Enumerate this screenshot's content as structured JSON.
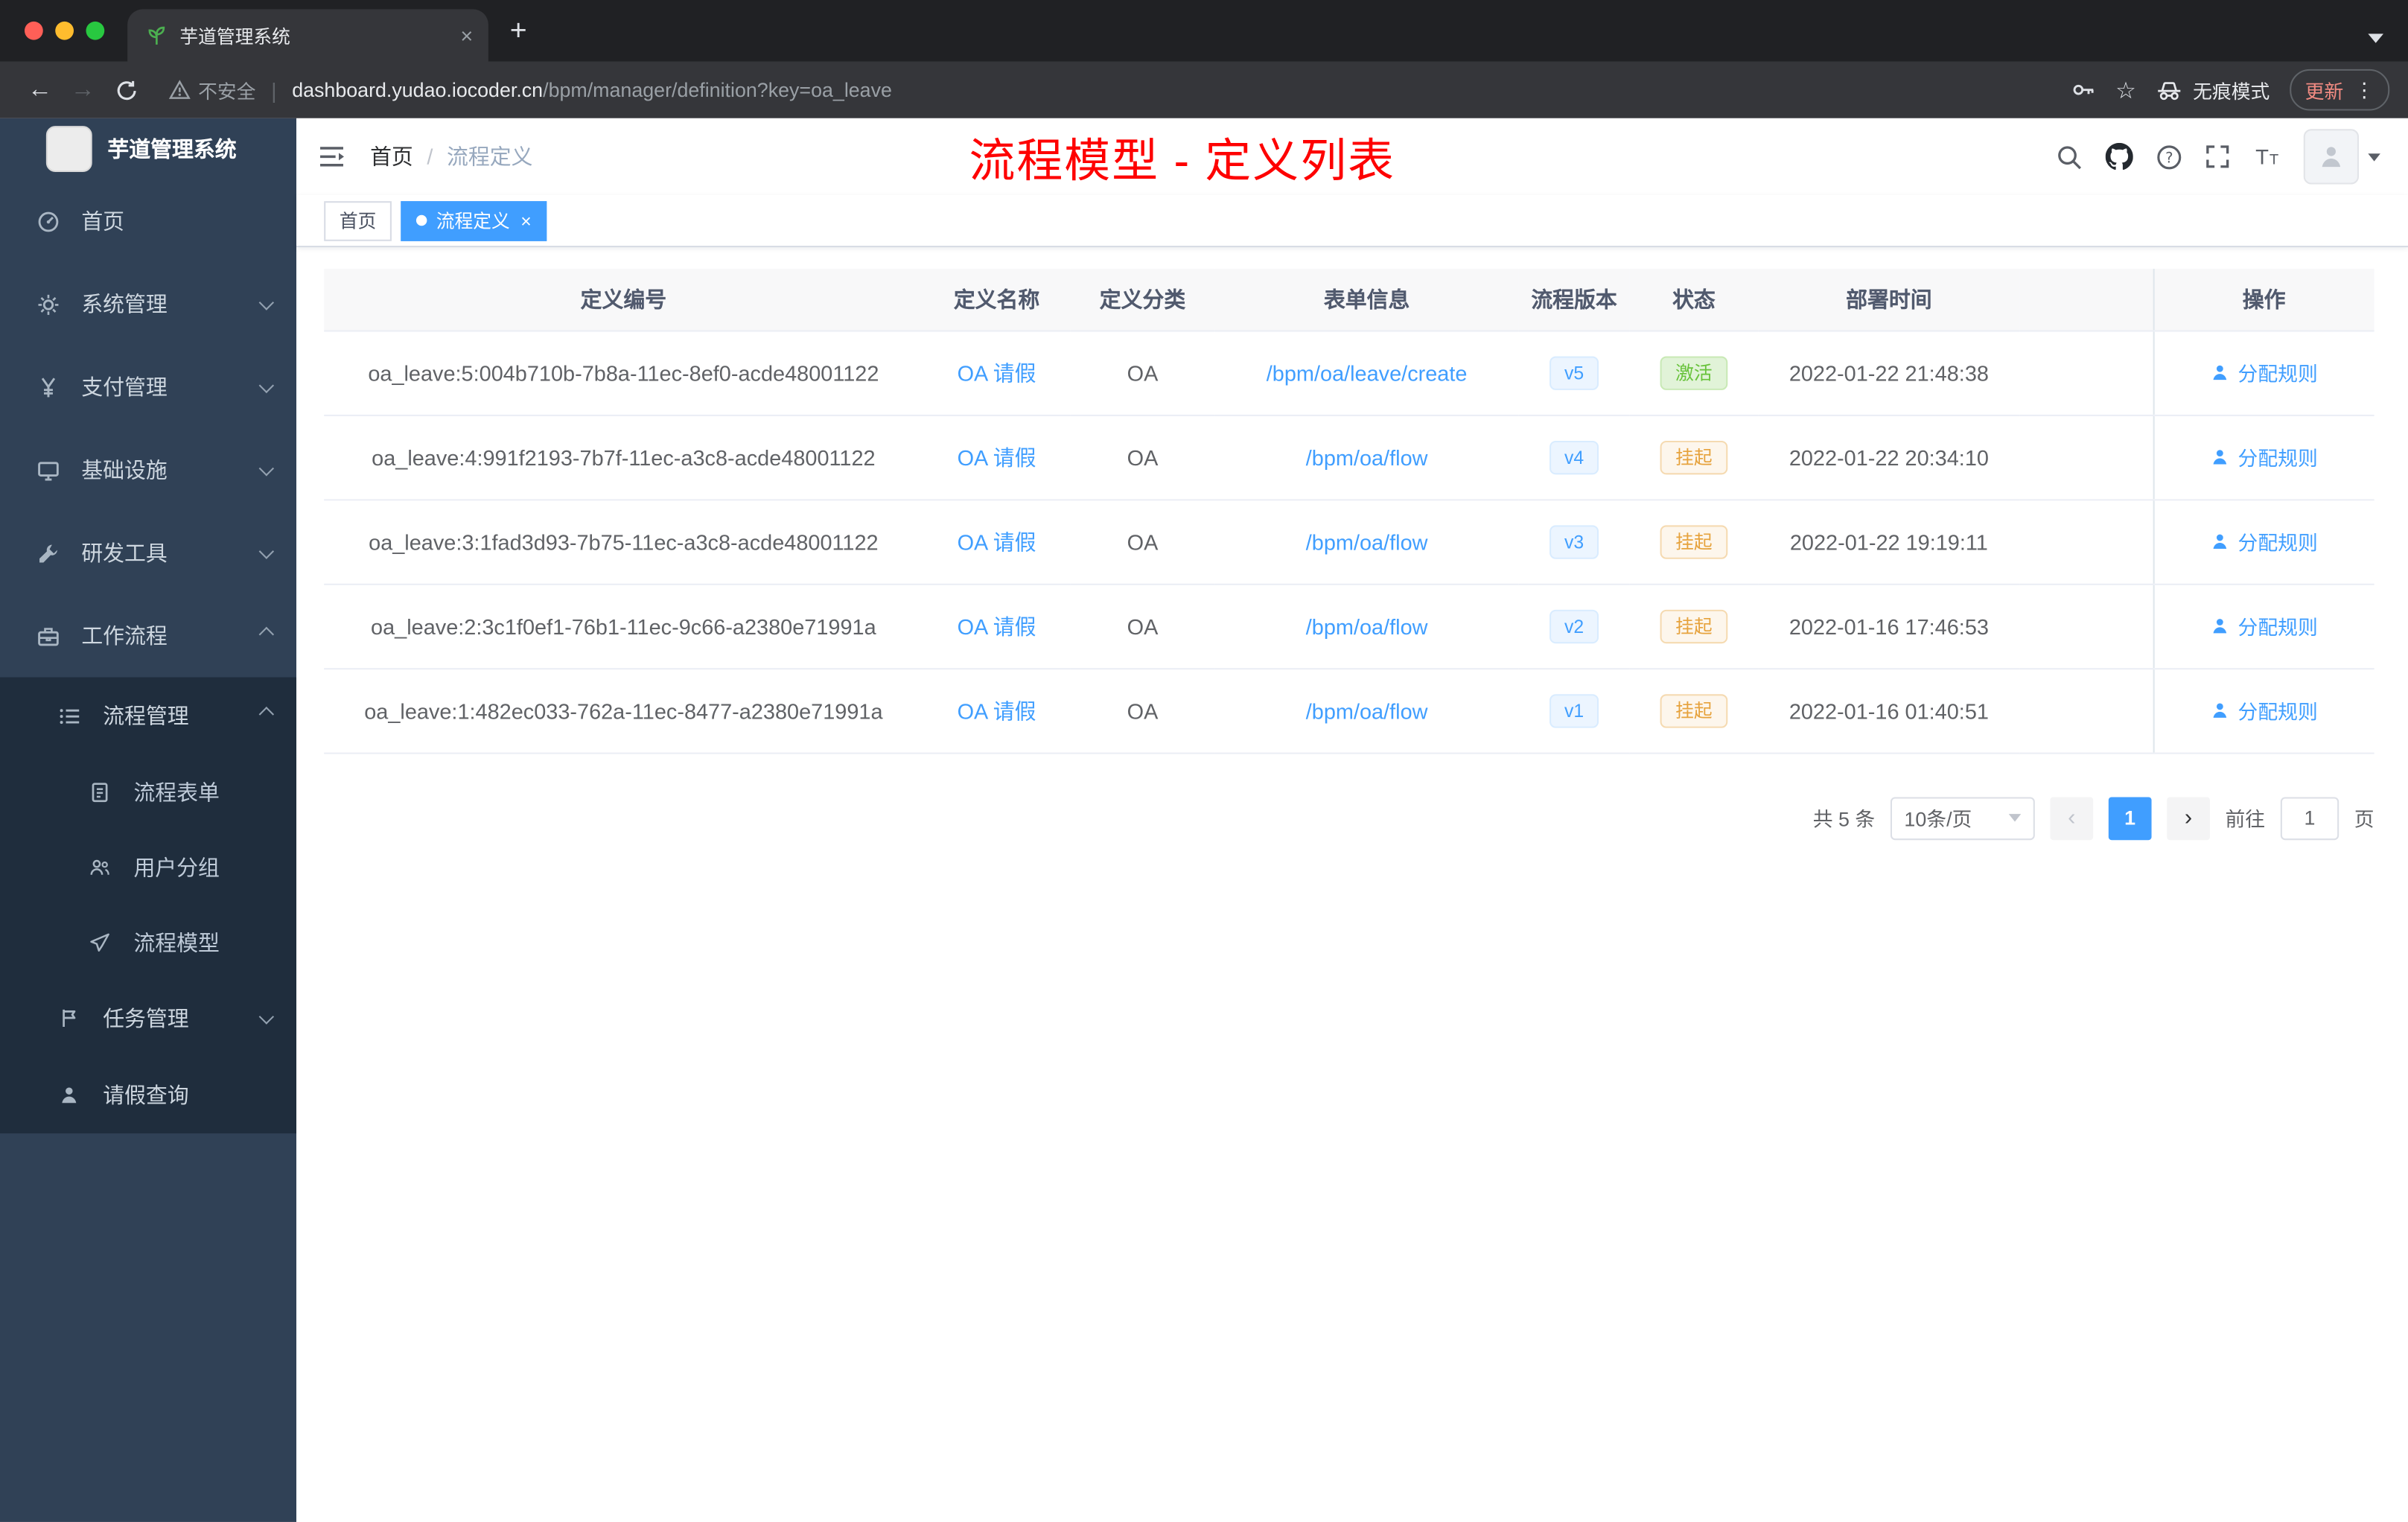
{
  "browser": {
    "tab_title": "芋道管理系统",
    "security_label": "不安全",
    "url_host": "dashboard.yudao.iocoder.cn",
    "url_path": "/bpm/manager/definition?key=oa_leave",
    "incognito_label": "无痕模式",
    "update_label": "更新"
  },
  "glyphs": {
    "close_tab": "×",
    "new_tab": "+",
    "back": "←",
    "forward": "→",
    "star": "☆",
    "menu_dots": "⋮",
    "tag_close": "×",
    "prev": "‹",
    "next": "›"
  },
  "sidebar": {
    "logo_title": "芋道管理系统",
    "items": [
      {
        "label": "首页"
      },
      {
        "label": "系统管理"
      },
      {
        "label": "支付管理"
      },
      {
        "label": "基础设施"
      },
      {
        "label": "研发工具"
      },
      {
        "label": "工作流程"
      },
      {
        "label": "流程管理"
      },
      {
        "label": "流程表单"
      },
      {
        "label": "用户分组"
      },
      {
        "label": "流程模型"
      },
      {
        "label": "任务管理"
      },
      {
        "label": "请假查询"
      }
    ]
  },
  "header": {
    "breadcrumb": {
      "home": "首页",
      "separator": "/",
      "current": "流程定义"
    },
    "annotation": "流程模型 - 定义列表"
  },
  "tags": {
    "home": "首页",
    "active": "流程定义"
  },
  "table": {
    "columns": [
      "定义编号",
      "定义名称",
      "定义分类",
      "表单信息",
      "流程版本",
      "状态",
      "部署时间",
      "操作"
    ],
    "rows": [
      {
        "id": "oa_leave:5:004b710b-7b8a-11ec-8ef0-acde48001122",
        "name": "OA 请假",
        "category": "OA",
        "form": "/bpm/oa/leave/create",
        "version": "v5",
        "status": "激活",
        "status_type": "success",
        "deploy_time": "2022-01-22 21:48:38",
        "action": "分配规则"
      },
      {
        "id": "oa_leave:4:991f2193-7b7f-11ec-a3c8-acde48001122",
        "name": "OA 请假",
        "category": "OA",
        "form": "/bpm/oa/flow",
        "version": "v4",
        "status": "挂起",
        "status_type": "warning",
        "deploy_time": "2022-01-22 20:34:10",
        "action": "分配规则"
      },
      {
        "id": "oa_leave:3:1fad3d93-7b75-11ec-a3c8-acde48001122",
        "name": "OA 请假",
        "category": "OA",
        "form": "/bpm/oa/flow",
        "version": "v3",
        "status": "挂起",
        "status_type": "warning",
        "deploy_time": "2022-01-22 19:19:11",
        "action": "分配规则"
      },
      {
        "id": "oa_leave:2:3c1f0ef1-76b1-11ec-9c66-a2380e71991a",
        "name": "OA 请假",
        "category": "OA",
        "form": "/bpm/oa/flow",
        "version": "v2",
        "status": "挂起",
        "status_type": "warning",
        "deploy_time": "2022-01-16 17:46:53",
        "action": "分配规则"
      },
      {
        "id": "oa_leave:1:482ec033-762a-11ec-8477-a2380e71991a",
        "name": "OA 请假",
        "category": "OA",
        "form": "/bpm/oa/flow",
        "version": "v1",
        "status": "挂起",
        "status_type": "warning",
        "deploy_time": "2022-01-16 01:40:51",
        "action": "分配规则"
      }
    ]
  },
  "pagination": {
    "total": "共 5 条",
    "page_size": "10条/页",
    "current_page": "1",
    "goto_label": "前往",
    "goto_value": "1",
    "goto_unit": "页"
  },
  "colors": {
    "accent": "#409eff",
    "annotation_red": "#fe0000",
    "success_text": "#67c23a",
    "warning_text": "#e6a23c",
    "sidebar_bg": "#304156",
    "submenu_bg": "#1f2d3d"
  }
}
